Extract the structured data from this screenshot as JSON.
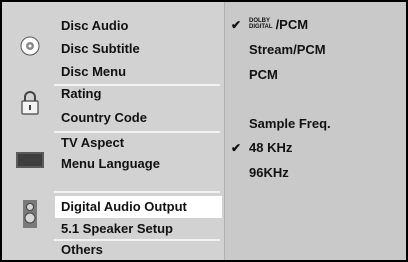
{
  "menu": {
    "items": [
      {
        "label": "Disc Audio"
      },
      {
        "label": "Disc Subtitle"
      },
      {
        "label": "Disc Menu"
      },
      {
        "label": "Rating"
      },
      {
        "label": "Country Code"
      },
      {
        "label": "TV Aspect"
      },
      {
        "label": "Menu Language"
      },
      {
        "label": "Digital Audio Output",
        "selected": true
      },
      {
        "label": "5.1 Speaker Setup"
      },
      {
        "label": "Others"
      }
    ],
    "icons": [
      "disc-icon",
      "lock-icon",
      "tv-icon",
      "speaker-icon"
    ]
  },
  "options": {
    "dolby_mark_top": "DOLBY",
    "dolby_mark_bottom": "DIGITAL",
    "dolby_pcm": "/PCM",
    "stream_pcm": "Stream/PCM",
    "pcm": "PCM",
    "sample_freq_label": "Sample Freq.",
    "freq_48": "48 KHz",
    "freq_96": "96KHz",
    "check_mark": "✔"
  }
}
